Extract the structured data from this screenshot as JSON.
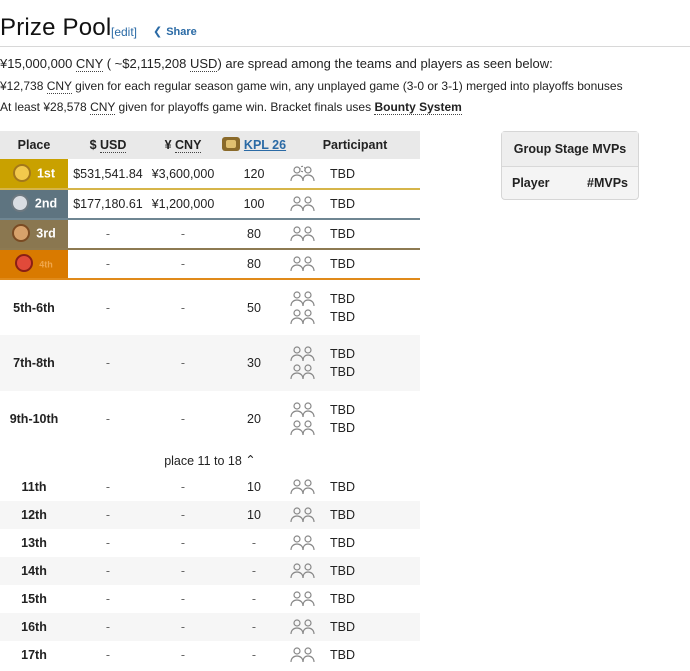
{
  "header": {
    "title": "Prize Pool",
    "edit": "[edit]",
    "share": "Share"
  },
  "intro": {
    "p1_a": "¥15,000,000 ",
    "p1_cny": "CNY",
    "p1_b": " ( ~$2,115,208 ",
    "p1_usd": "USD",
    "p1_c": ") are spread among the teams and players as seen below:",
    "p2_a": "¥12,738 ",
    "p2_cny": "CNY",
    "p2_b": " given for each regular season game win, any unplayed game (3-0 or 3-1) merged into playoffs bonuses",
    "p3_a": "At least ¥28,578 ",
    "p3_cny": "CNY",
    "p3_b": " given for playoffs game win. Bracket finals uses ",
    "p3_bold": "Bounty System"
  },
  "table": {
    "headers": {
      "place": "Place",
      "usd_symbol": "$ ",
      "usd": "USD",
      "cny_symbol": "¥ ",
      "cny": "CNY",
      "kpl": "KPL 26",
      "participant": "Participant"
    },
    "rows_top": [
      {
        "place": "1st",
        "usd": "$531,541.84",
        "cny": "¥3,600,000",
        "kpl": "120",
        "participant": "TBD"
      },
      {
        "place": "2nd",
        "usd": "$177,180.61",
        "cny": "¥1,200,000",
        "kpl": "100",
        "participant": "TBD"
      },
      {
        "place": "3rd",
        "usd": "-",
        "cny": "-",
        "kpl": "80",
        "participant": "TBD"
      },
      {
        "place": "4th",
        "usd": "-",
        "cny": "-",
        "kpl": "80",
        "participant": "TBD"
      }
    ],
    "rows_group": [
      {
        "place": "5th-6th",
        "usd": "-",
        "cny": "-",
        "kpl": "50",
        "p1": "TBD",
        "p2": "TBD"
      },
      {
        "place": "7th-8th",
        "usd": "-",
        "cny": "-",
        "kpl": "30",
        "p1": "TBD",
        "p2": "TBD"
      },
      {
        "place": "9th-10th",
        "usd": "-",
        "cny": "-",
        "kpl": "20",
        "p1": "TBD",
        "p2": "TBD"
      }
    ],
    "toggle": "place 11 to 18",
    "rows_rest": [
      {
        "place": "11th",
        "usd": "-",
        "cny": "-",
        "kpl": "10",
        "participant": "TBD"
      },
      {
        "place": "12th",
        "usd": "-",
        "cny": "-",
        "kpl": "10",
        "participant": "TBD"
      },
      {
        "place": "13th",
        "usd": "-",
        "cny": "-",
        "kpl": "-",
        "participant": "TBD"
      },
      {
        "place": "14th",
        "usd": "-",
        "cny": "-",
        "kpl": "-",
        "participant": "TBD"
      },
      {
        "place": "15th",
        "usd": "-",
        "cny": "-",
        "kpl": "-",
        "participant": "TBD"
      },
      {
        "place": "16th",
        "usd": "-",
        "cny": "-",
        "kpl": "-",
        "participant": "TBD"
      },
      {
        "place": "17th",
        "usd": "-",
        "cny": "-",
        "kpl": "-",
        "participant": "TBD"
      }
    ]
  },
  "mvp": {
    "title": "Group Stage MVPs",
    "col_player": "Player",
    "col_mvps": "#MVPs"
  },
  "colors": {
    "gold": "#c9a100",
    "silver": "#5e7480",
    "bronze": "#8a7750",
    "fourth": "#d97a00",
    "link": "#2a6aa5"
  }
}
